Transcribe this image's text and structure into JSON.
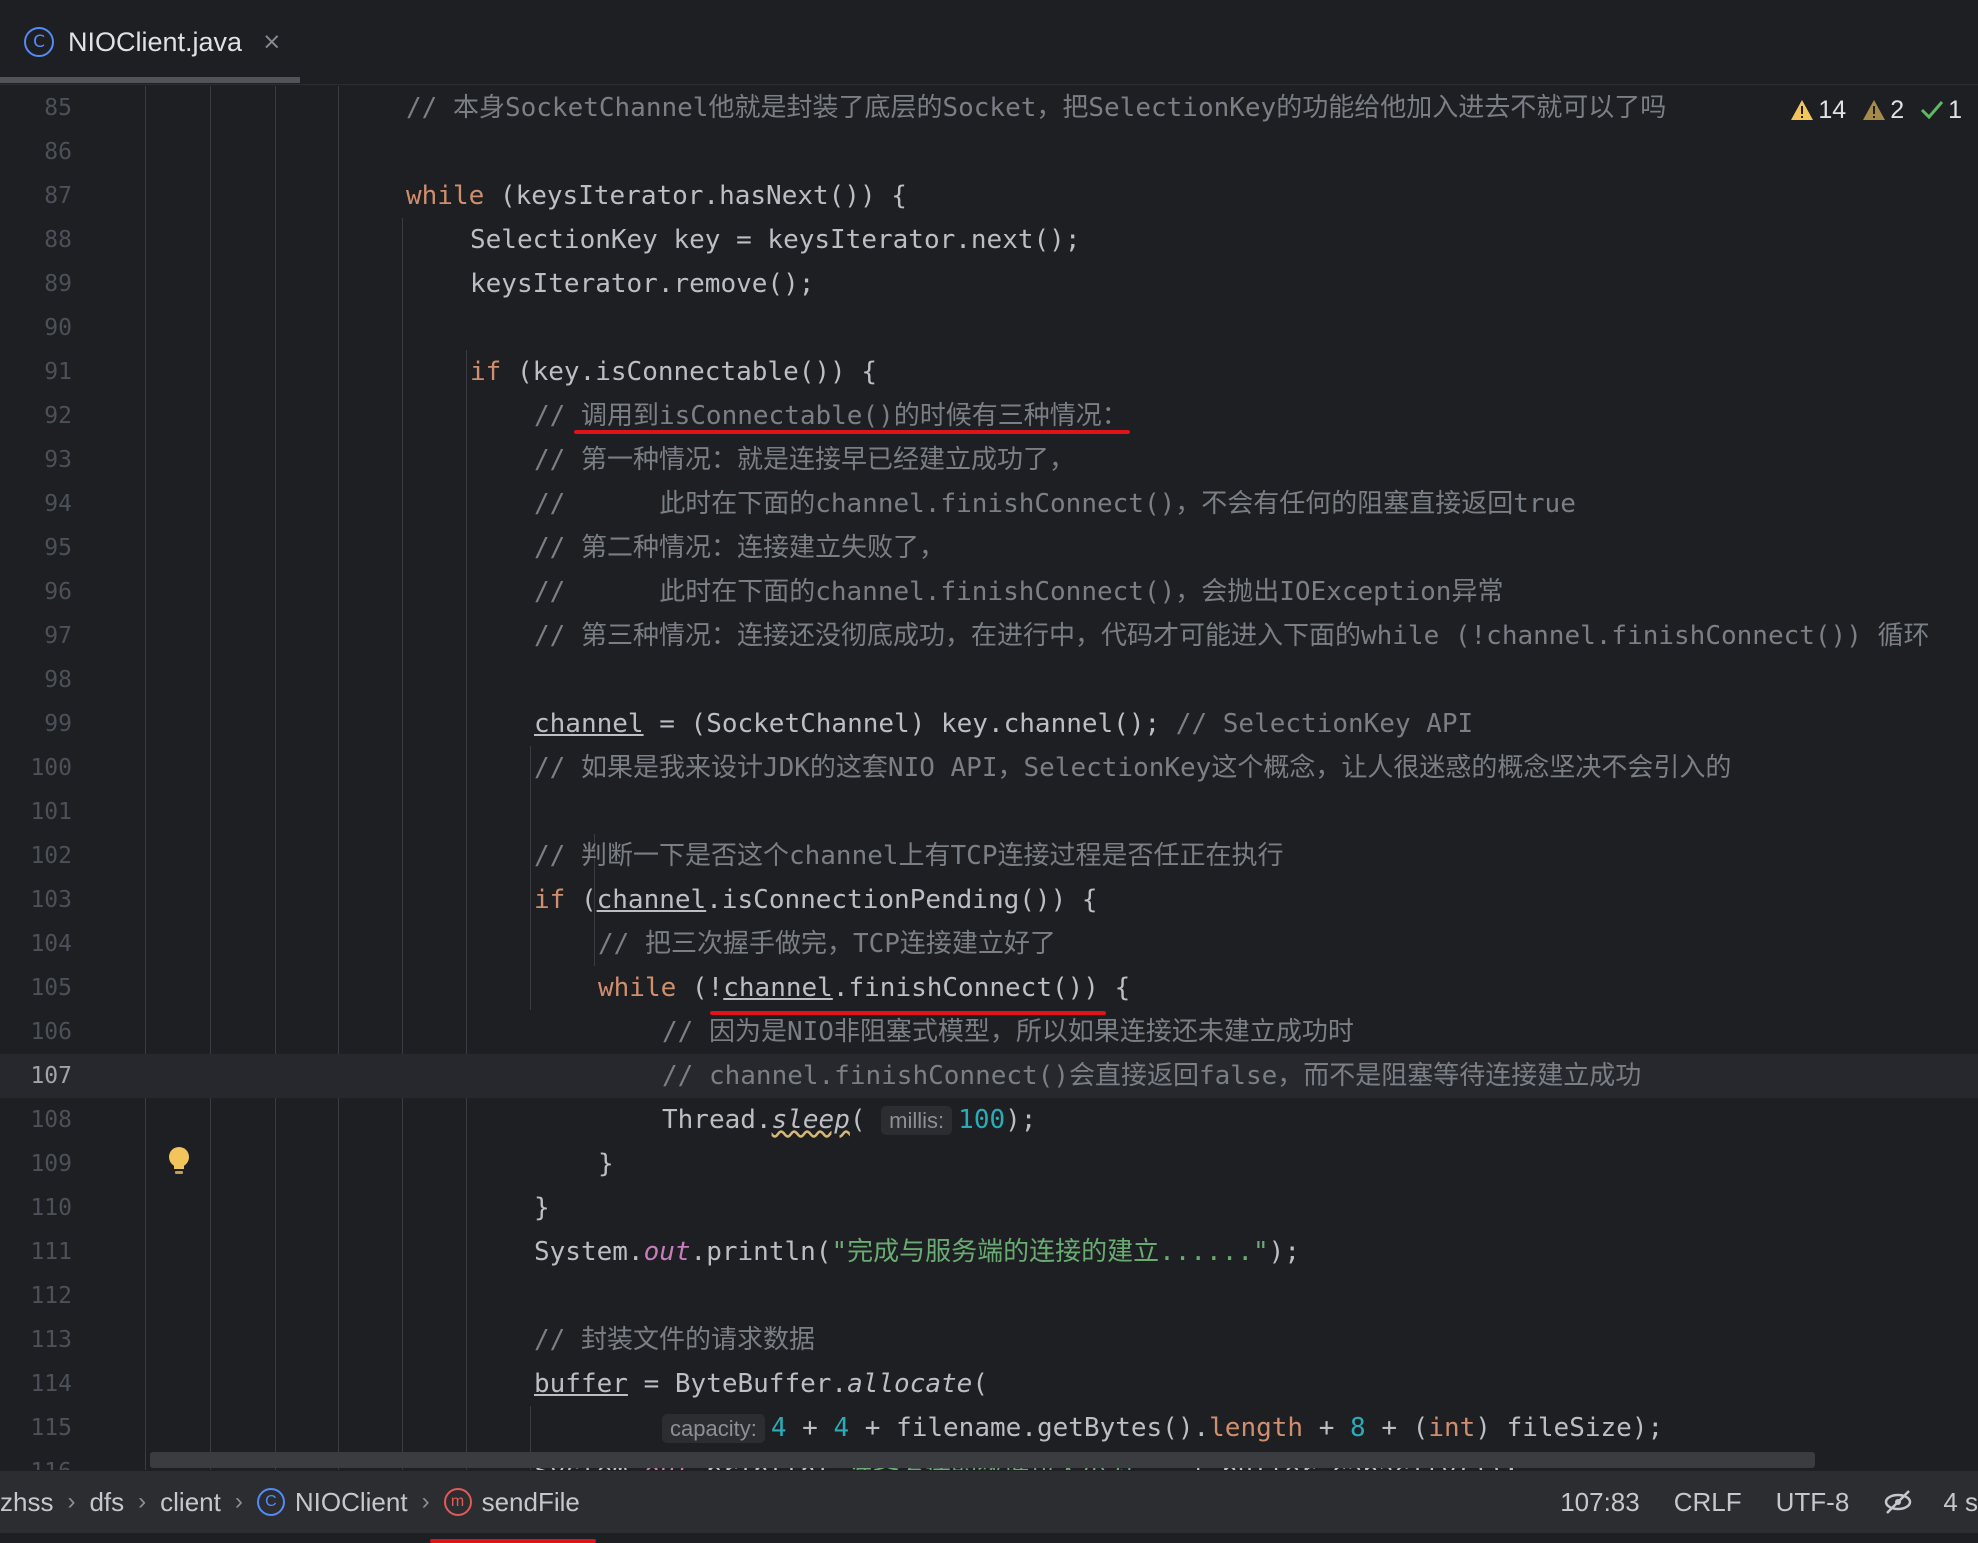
{
  "tab": {
    "icon_letter": "C",
    "label": "NIOClient.java",
    "close": "×"
  },
  "inspections": {
    "warnings": "14",
    "weak_warnings": "2",
    "ok": "1"
  },
  "lines": [
    {
      "n": "85",
      "segs": [
        [
          "cmt",
          "// 本身SocketChannel他就是封装了底层的Socket，把SelectionKey的功能给他加入进去不就可以了吗"
        ]
      ]
    },
    {
      "n": "86",
      "segs": []
    },
    {
      "n": "87",
      "segs": [
        [
          "kw",
          "while"
        ],
        [
          "",
          " (keysIterator.hasNext()) {"
        ]
      ]
    },
    {
      "n": "88",
      "segs": [
        [
          "",
          "SelectionKey key = keysIterator.next();"
        ]
      ]
    },
    {
      "n": "89",
      "segs": [
        [
          "",
          "keysIterator.remove();"
        ]
      ]
    },
    {
      "n": "90",
      "segs": []
    },
    {
      "n": "91",
      "segs": [
        [
          "kw",
          "if"
        ],
        [
          "",
          " (key.isConnectable()) {"
        ]
      ]
    },
    {
      "n": "92",
      "segs": [
        [
          "cmt",
          "// 调用到isConnectable()的时候有三种情况："
        ]
      ]
    },
    {
      "n": "93",
      "segs": [
        [
          "cmt",
          "// 第一种情况：就是连接早已经建立成功了，"
        ]
      ]
    },
    {
      "n": "94",
      "segs": [
        [
          "cmt",
          "//      此时在下面的channel.finishConnect()，不会有任何的阻塞直接返回true"
        ]
      ]
    },
    {
      "n": "95",
      "segs": [
        [
          "cmt",
          "// 第二种情况：连接建立失败了，"
        ]
      ]
    },
    {
      "n": "96",
      "segs": [
        [
          "cmt",
          "//      此时在下面的channel.finishConnect()，会抛出IOException异常"
        ]
      ]
    },
    {
      "n": "97",
      "segs": [
        [
          "cmt",
          "// 第三种情况：连接还没彻底成功，在进行中，代码才可能进入下面的while (!channel.finishConnect()) 循环"
        ]
      ]
    },
    {
      "n": "98",
      "segs": []
    },
    {
      "n": "99",
      "segs": [
        [
          "ul",
          "channel"
        ],
        [
          "",
          " = (SocketChannel) key.channel(); "
        ],
        [
          "cmt",
          "// SelectionKey API"
        ]
      ]
    },
    {
      "n": "100",
      "segs": [
        [
          "cmt",
          "// 如果是我来设计JDK的这套NIO API，SelectionKey这个概念，让人很迷惑的概念坚决不会引入的"
        ]
      ]
    },
    {
      "n": "101",
      "segs": []
    },
    {
      "n": "102",
      "segs": [
        [
          "cmt",
          "// 判断一下是否这个channel上有TCP连接过程是否任正在执行"
        ]
      ]
    },
    {
      "n": "103",
      "segs": [
        [
          "kw",
          "if"
        ],
        [
          "",
          " ("
        ],
        [
          "ul",
          "channel"
        ],
        [
          "",
          ".isConnectionPending()) {"
        ]
      ]
    },
    {
      "n": "104",
      "segs": [
        [
          "cmt",
          "// 把三次握手做完，TCP连接建立好了"
        ]
      ]
    },
    {
      "n": "105",
      "segs": [
        [
          "kw",
          "while"
        ],
        [
          "",
          " (!"
        ],
        [
          "ul",
          "channel"
        ],
        [
          "",
          ".finishConnect()) {"
        ]
      ]
    },
    {
      "n": "106",
      "segs": [
        [
          "cmt",
          "// 因为是NIO非阻塞式模型，所以如果连接还未建立成功时"
        ]
      ]
    },
    {
      "n": "107",
      "segs": [
        [
          "cmt",
          "// channel.finishConnect()会直接返回false，而不是阻塞等待连接建立成功"
        ]
      ]
    },
    {
      "n": "108",
      "segs": [
        [
          "",
          "Thread."
        ],
        [
          "itl wavy",
          "sleep"
        ],
        [
          "",
          "( "
        ],
        [
          "hint",
          "millis:"
        ],
        [
          "num",
          "100"
        ],
        [
          "",
          ");"
        ]
      ]
    },
    {
      "n": "109",
      "segs": [
        [
          "",
          "}"
        ]
      ]
    },
    {
      "n": "110",
      "segs": [
        [
          "",
          "}"
        ]
      ]
    },
    {
      "n": "111",
      "segs": [
        [
          "",
          "System."
        ],
        [
          "fld",
          "out"
        ],
        [
          "",
          ".println("
        ],
        [
          "str",
          "\"完成与服务端的连接的建立......\""
        ],
        [
          "",
          ");"
        ]
      ]
    },
    {
      "n": "112",
      "segs": []
    },
    {
      "n": "113",
      "segs": [
        [
          "cmt",
          "// 封装文件的请求数据"
        ]
      ]
    },
    {
      "n": "114",
      "segs": [
        [
          "ul",
          "buffer"
        ],
        [
          "",
          " = ByteBuffer."
        ],
        [
          "itl",
          "allocate"
        ],
        [
          "",
          "("
        ]
      ]
    },
    {
      "n": "115",
      "segs": [
        [
          "hint",
          "capacity:"
        ],
        [
          "num",
          "4"
        ],
        [
          "",
          " + "
        ],
        [
          "num",
          "4"
        ],
        [
          "",
          " + filename.getBytes()."
        ],
        [
          "kw",
          "length"
        ],
        [
          "",
          " + "
        ],
        [
          "num",
          "8"
        ],
        [
          "",
          " + ("
        ],
        [
          "kw",
          "int"
        ],
        [
          "",
          ") fileSize);"
        ]
      ]
    },
    {
      "n": "116",
      "segs": [
        [
          "",
          "System."
        ],
        [
          "fld",
          "out"
        ],
        [
          "",
          ".println("
        ],
        [
          "str",
          "\"准备发送的数据包大小为：\""
        ],
        [
          "",
          " + buffer.capacity());"
        ]
      ]
    }
  ],
  "status": {
    "breadcrumbs": [
      "zhss",
      "dfs",
      "client",
      "NIOClient",
      "sendFile"
    ],
    "position": "107:83",
    "line_ending": "CRLF",
    "encoding": "UTF-8",
    "indent": "4 s"
  },
  "colors": {
    "background": "#1e1f22",
    "keyword": "#cf8e6d",
    "comment": "#7a7e85",
    "string": "#6aab73",
    "number": "#2aacb8",
    "field": "#c77dbb",
    "annotation_red": "#e0121a"
  }
}
